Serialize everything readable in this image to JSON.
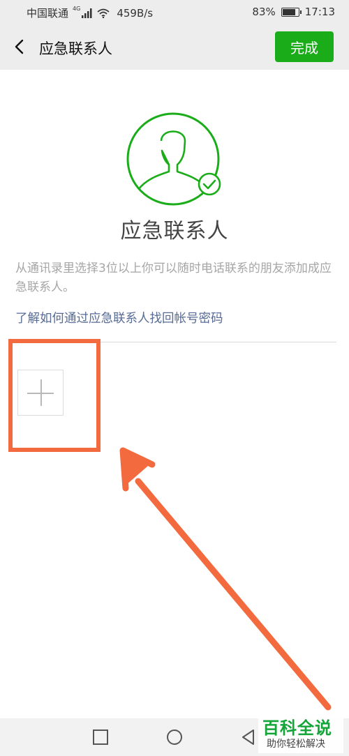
{
  "status": {
    "carrier": "中国联通",
    "network_type": "4G",
    "speed": "459B/s",
    "battery": "83%",
    "battery_level": 0.83,
    "time": "17:13"
  },
  "header": {
    "back_icon": "chevron-left-icon",
    "title": "应急联系人",
    "done_label": "完成",
    "done_color": "#1aad19"
  },
  "hero": {
    "avatar_icon": "user-check-icon",
    "accent": "#1aad19",
    "title": "应急联系人"
  },
  "description": "从通讯录里选择3位以上你可以随时电话联系的朋友添加成应急联系人。",
  "help_link": "了解如何通过应急联系人找回帐号密码",
  "add_contact_icon": "plus-icon",
  "annotation_color": "#f26a3e",
  "watermark": {
    "title": "百科全说",
    "subtitle": "助你轻松解决"
  }
}
